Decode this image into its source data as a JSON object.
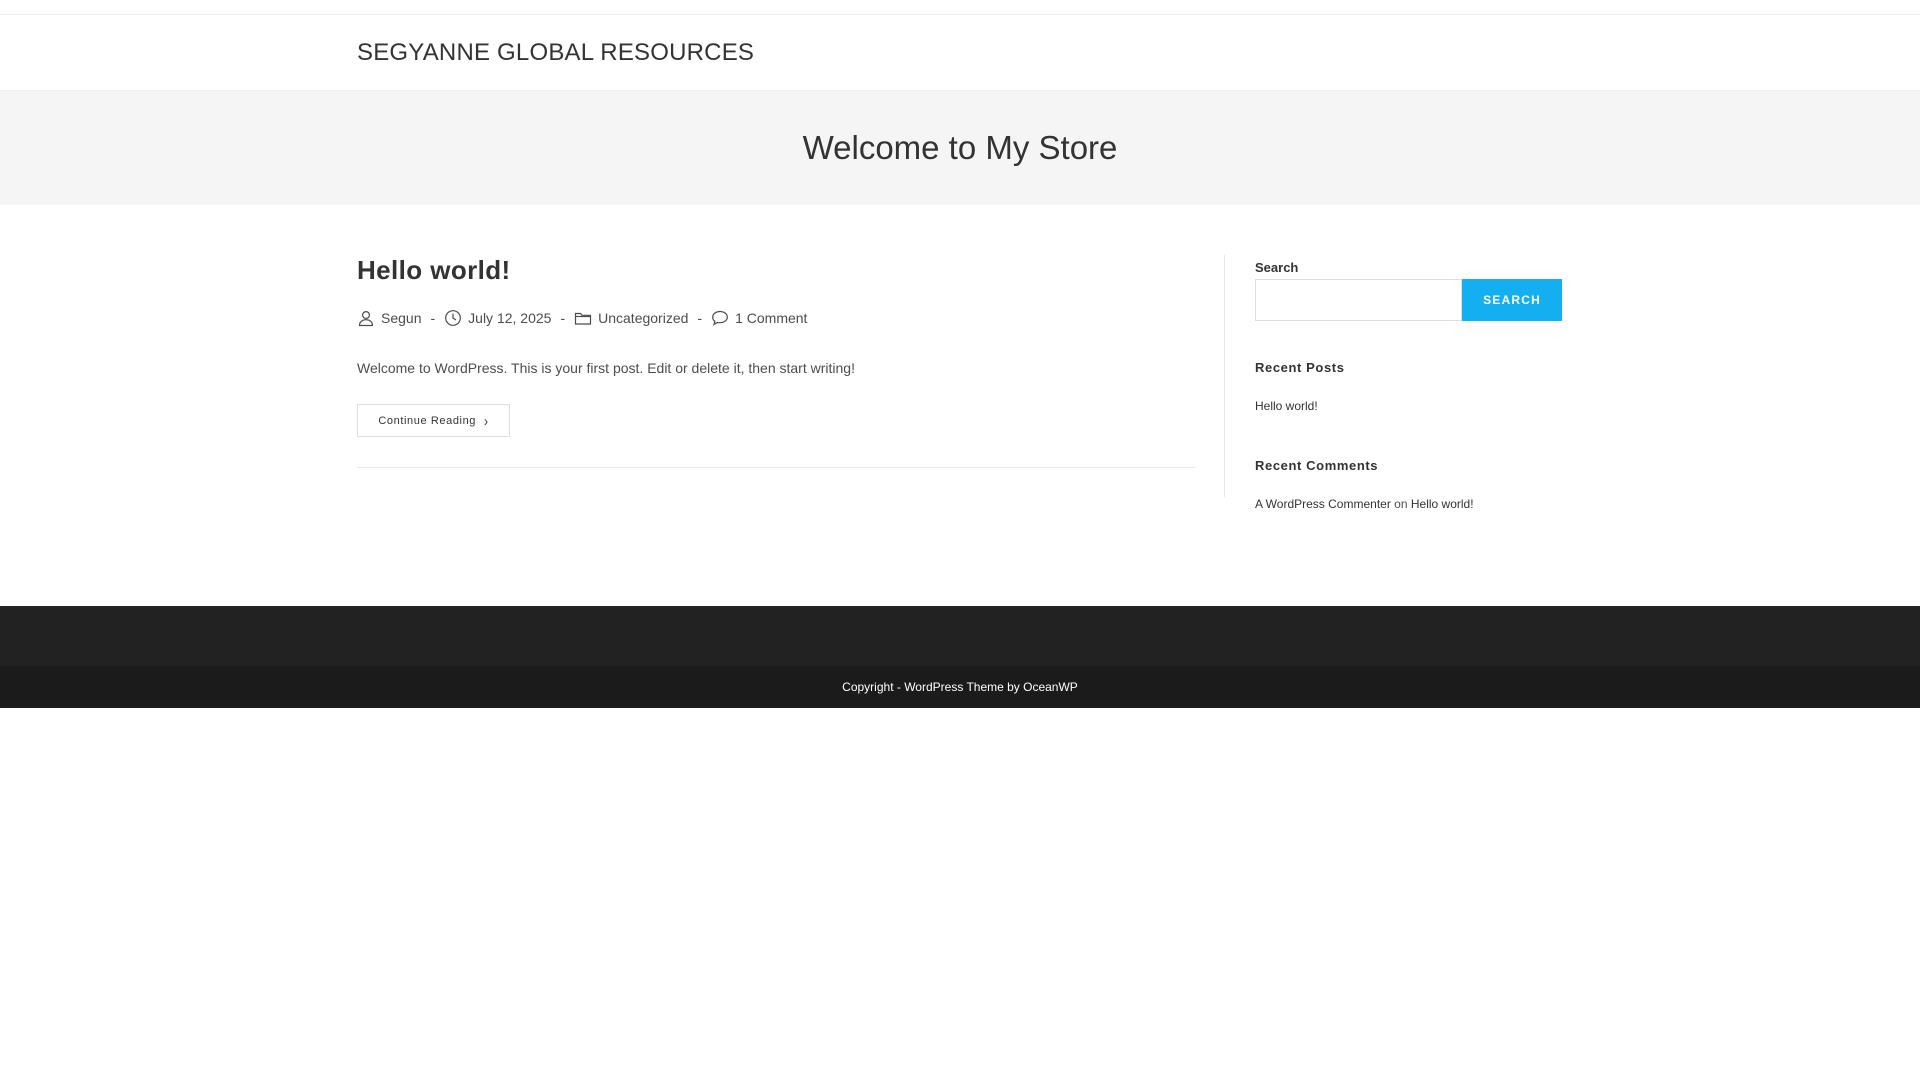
{
  "header": {
    "site_title": "SEGYANNE GLOBAL RESOURCES"
  },
  "page_header": {
    "title": "Welcome to My Store"
  },
  "post": {
    "title": "Hello world!",
    "author": "Segun",
    "date": "July 12, 2025",
    "category": "Uncategorized",
    "comments": "1 Comment",
    "separator": "-",
    "excerpt": "Welcome to WordPress. This is your first post. Edit or delete it, then start writing!",
    "continue_label": "Continue Reading",
    "continue_icon": "chevron-right-icon"
  },
  "sidebar": {
    "search": {
      "label": "Search",
      "value": "",
      "button_label": "SEARCH"
    },
    "recent_posts": {
      "title": "Recent Posts",
      "items": [
        "Hello world!"
      ]
    },
    "recent_comments": {
      "title": "Recent Comments",
      "author": "A WordPress Commenter",
      "connector": "on",
      "post": "Hello world!"
    }
  },
  "footer": {
    "copyright": "Copyright - WordPress Theme by OceanWP"
  },
  "colors": {
    "accent": "#13aff0",
    "footer_bg": "#222222",
    "footer_bottom_bg": "#1b1b1b",
    "page_header_bg": "#f5f5f5"
  },
  "icons": {
    "author": "user-icon",
    "date": "clock-icon",
    "category": "folder-icon",
    "comments": "comment-icon"
  }
}
